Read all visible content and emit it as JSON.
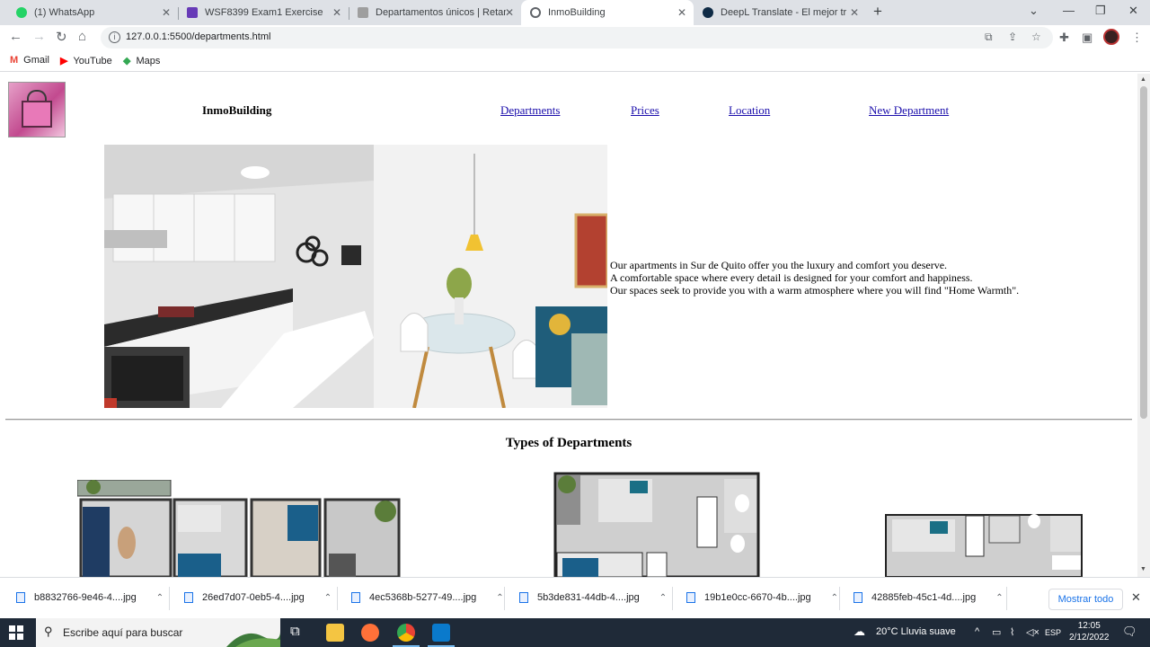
{
  "browser": {
    "tabs": [
      {
        "title": "(1) WhatsApp",
        "color": "#25d366"
      },
      {
        "title": "WSF8399 Exam1 Exercise",
        "color": "#673ab7"
      },
      {
        "title": "Departamentos únicos | Retamo",
        "color": "#9e9e9e"
      },
      {
        "title": "InmoBuilding",
        "color": "#5f6368"
      },
      {
        "title": "DeepL Translate - El mejor traductor",
        "color": "#0f2b46"
      }
    ],
    "url": "127.0.0.1:5500/departments.html",
    "bookmarks": [
      {
        "label": "Gmail",
        "icon": "M",
        "color": "#ea4335"
      },
      {
        "label": "YouTube",
        "icon": "▶",
        "color": "#ff0000"
      },
      {
        "label": "Maps",
        "icon": "◆",
        "color": "#34a853"
      }
    ]
  },
  "site": {
    "brand": "InmoBuilding",
    "nav": [
      "Departments",
      "Prices",
      "Location",
      "New Department"
    ],
    "intro": [
      "Our apartments in Sur de Quito offer you the luxury and comfort you deserve.",
      "A comfortable space where every detail is designed for your comfort and happiness.",
      "Our spaces seek to provide you with a warm atmosphere where you will find \"Home Warmth\"."
    ],
    "types_title": "Types of Departments"
  },
  "downloads": {
    "files": [
      "b8832766-9e46-4....jpg",
      "26ed7d07-0eb5-4....jpg",
      "4ec5368b-5277-49....jpg",
      "5b3de831-44db-4....jpg",
      "19b1e0cc-6670-4b....jpg",
      "42885feb-45c1-4d....jpg"
    ],
    "show_all": "Mostrar todo"
  },
  "taskbar": {
    "search_placeholder": "Escribe aquí para buscar",
    "weather": "20°C  Lluvia suave",
    "lang": "ESP",
    "time": "12:05",
    "date": "2/12/2022"
  }
}
